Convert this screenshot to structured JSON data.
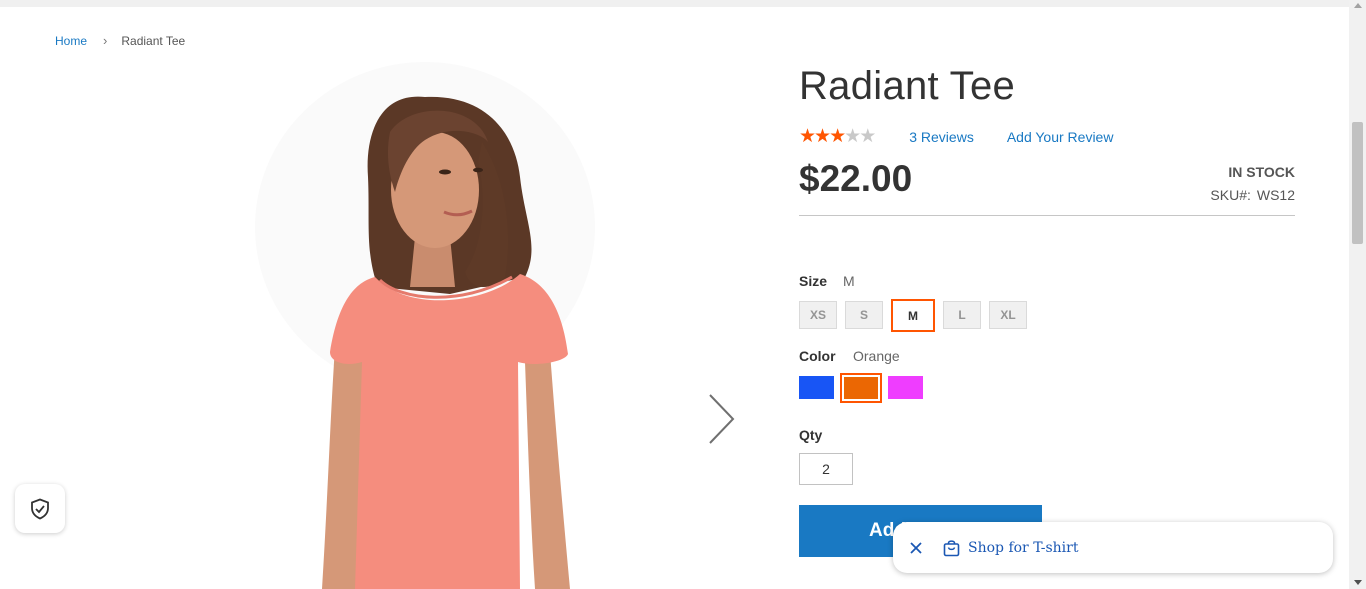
{
  "breadcrumb": {
    "home": "Home",
    "separator": "›",
    "current": "Radiant Tee"
  },
  "product": {
    "title": "Radiant Tee",
    "rating": {
      "filled": 3,
      "total": 5
    },
    "reviews_count_label": "3  Reviews",
    "add_review_label": "Add Your Review",
    "price": "$22.00",
    "stock": "IN STOCK",
    "sku_label": "SKU#:",
    "sku_value": "WS12"
  },
  "options": {
    "size": {
      "label": "Size",
      "selected": "M",
      "values": [
        "XS",
        "S",
        "M",
        "L",
        "XL"
      ]
    },
    "color": {
      "label": "Color",
      "selected": "Orange",
      "swatches": [
        {
          "name": "Blue",
          "hex": "#1855f5"
        },
        {
          "name": "Orange",
          "hex": "#eb6703"
        },
        {
          "name": "Purple",
          "hex": "#ef3dff"
        }
      ]
    }
  },
  "qty": {
    "label": "Qty",
    "value": "2"
  },
  "add_to_cart_label": "Add to Cart",
  "popup": {
    "text": "Shop for T-shirt"
  },
  "colors": {
    "link": "#1979c3",
    "accent": "#ff5501",
    "button": "#1979c3"
  },
  "icons": [
    "chevron-right-icon",
    "close-icon",
    "shopping-bag-icon",
    "shield-check-icon",
    "star-icon"
  ]
}
